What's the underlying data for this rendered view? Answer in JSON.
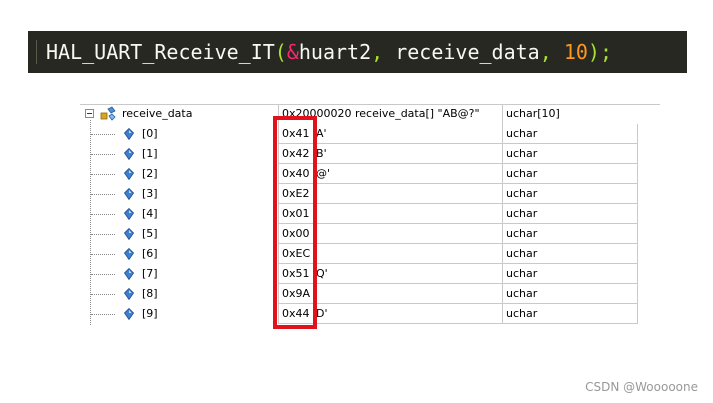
{
  "code_line": {
    "tokens": [
      {
        "text": "HAL_UART_Receive_IT",
        "color": "#f8f8f2"
      },
      {
        "text": "(",
        "color": "#a6e22e"
      },
      {
        "text": "&",
        "color": "#f92672"
      },
      {
        "text": "huart2",
        "color": "#f8f8f2"
      },
      {
        "text": ",",
        "color": "#a6e22e"
      },
      {
        "text": " receive_data",
        "color": "#f8f8f2"
      },
      {
        "text": ",",
        "color": "#a6e22e"
      },
      {
        "text": " ",
        "color": "#f8f8f2"
      },
      {
        "text": "10",
        "color": "#fd971f"
      },
      {
        "text": ");",
        "color": "#a6e22e"
      }
    ]
  },
  "watch": {
    "root": {
      "name": "receive_data",
      "value": "0x20000020 receive_data[] \"AB@?\"",
      "type": "uchar[10]"
    },
    "elements": [
      {
        "index": "[0]",
        "value": "0x41 'A'",
        "type": "uchar"
      },
      {
        "index": "[1]",
        "value": "0x42 'B'",
        "type": "uchar"
      },
      {
        "index": "[2]",
        "value": "0x40 '@'",
        "type": "uchar"
      },
      {
        "index": "[3]",
        "value": "0xE2 '",
        "type": "uchar"
      },
      {
        "index": "[4]",
        "value": "0x01",
        "type": "uchar"
      },
      {
        "index": "[5]",
        "value": "0x00",
        "type": "uchar"
      },
      {
        "index": "[6]",
        "value": "0xEC '",
        "type": "uchar"
      },
      {
        "index": "[7]",
        "value": "0x51 'Q'",
        "type": "uchar"
      },
      {
        "index": "[8]",
        "value": "0x9A '",
        "type": "uchar"
      },
      {
        "index": "[9]",
        "value": "0x44 'D'",
        "type": "uchar"
      }
    ]
  },
  "highlight_color": "#e0121b",
  "watermark": "CSDN @Wooooone"
}
